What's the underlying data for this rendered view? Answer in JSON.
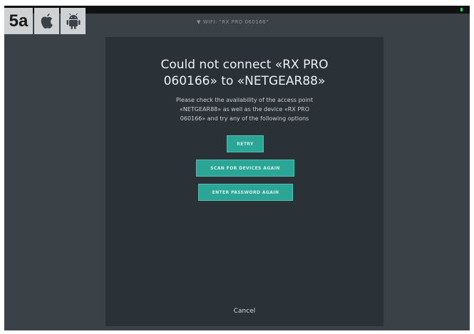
{
  "badge": {
    "step": "5a",
    "icons": [
      "apple-icon",
      "android-icon"
    ]
  },
  "status_bar": {
    "wifi": "WIFI: \"RX PRO 060166\""
  },
  "dialog": {
    "title_line1": "Could not connect «RX PRO",
    "title_line2": "060166» to «NETGEAR88»",
    "message_line1": "Please check the availability of the access point",
    "message_line2": "«NETGEAR88» as well as the device «RX PRO",
    "message_line3": "060166» and try any of the following options",
    "buttons": {
      "retry": "RETRY",
      "scan": "SCAN FOR DEVICES AGAIN",
      "password": "ENTER PASSWORD AGAIN"
    },
    "cancel": "Cancel"
  },
  "colors": {
    "background": "#3a4248",
    "dialog": "#2b3237",
    "accent": "#2aa596"
  }
}
